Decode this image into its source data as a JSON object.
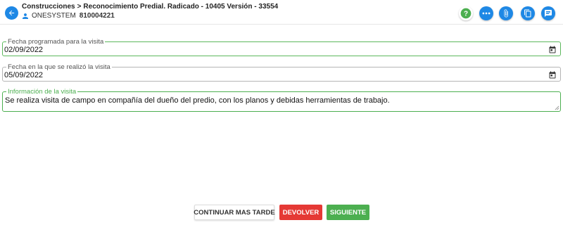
{
  "header": {
    "breadcrumb_1": "Construcciones",
    "breadcrumb_separator": ">",
    "breadcrumb_2": "Reconocimiento Predial. Radicado - 10405 Versión - 33554",
    "user_name": "ONESYSTEM",
    "user_id": "810004221",
    "help_icon_glyph": "?"
  },
  "fields": {
    "scheduled_date": {
      "label": "Fecha programada para la visita",
      "value": "02/09/2022"
    },
    "performed_date": {
      "label": "Fecha en la que se realizó la visita",
      "value": "05/09/2022"
    },
    "visit_info": {
      "label": "Información de la visita",
      "value": "Se realiza visita de campo en compañía del dueño del predio, con los planos y debidas herramientas de trabajo."
    }
  },
  "actions": {
    "continue_later": "CONTINUAR MAS TARDE",
    "return": "DEVOLVER",
    "next": "SIGUIENTE"
  },
  "icons": [
    "arrow-left-icon",
    "user-icon",
    "help-icon",
    "more-icon",
    "attachment-icon",
    "copy-icon",
    "comment-icon",
    "calendar-icon"
  ],
  "colors": {
    "primary": "#1e88e5",
    "success": "#4caf50",
    "danger": "#e53935"
  }
}
